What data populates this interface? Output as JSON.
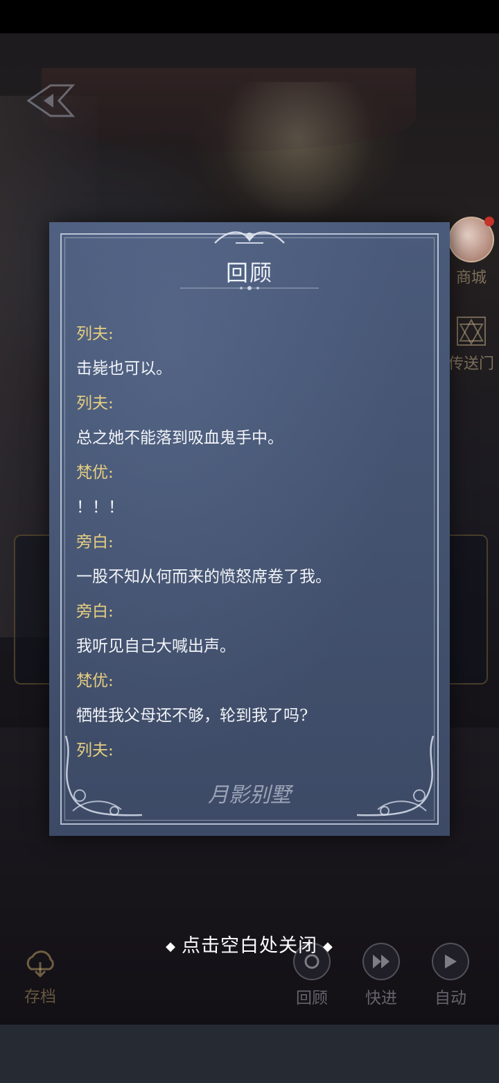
{
  "review": {
    "title": "回顾",
    "entries": [
      {
        "type": "speaker",
        "text": "列夫:"
      },
      {
        "type": "line",
        "text": "击毙也可以。"
      },
      {
        "type": "speaker",
        "text": "列夫:"
      },
      {
        "type": "line",
        "text": "总之她不能落到吸血鬼手中。"
      },
      {
        "type": "speaker",
        "text": "梵优:"
      },
      {
        "type": "line",
        "text": "！！！"
      },
      {
        "type": "speaker",
        "text": "旁白:"
      },
      {
        "type": "line",
        "text": "一股不知从何而来的愤怒席卷了我。"
      },
      {
        "type": "speaker",
        "text": "旁白:"
      },
      {
        "type": "line",
        "text": "我听见自己大喊出声。"
      },
      {
        "type": "speaker",
        "text": "梵优:"
      },
      {
        "type": "line",
        "text": "牺牲我父母还不够，轮到我了吗?"
      },
      {
        "type": "speaker",
        "text": "列夫:"
      }
    ],
    "logo_text": "月影别墅"
  },
  "close_hint": "点击空白处关闭",
  "side_menu": {
    "shop_label": "商城",
    "portal_label": "传送门"
  },
  "controls": {
    "save_label": "存档",
    "review_label": "回顾",
    "fast_label": "快进",
    "auto_label": "自动"
  },
  "colors": {
    "speaker": "#e6cf82",
    "text": "#f2f4f8",
    "panel": "#43526f"
  },
  "icons": [
    "back-icon",
    "shop-avatar",
    "portal-icon",
    "save-icon",
    "review-icon",
    "fast-forward-icon",
    "play-icon"
  ]
}
